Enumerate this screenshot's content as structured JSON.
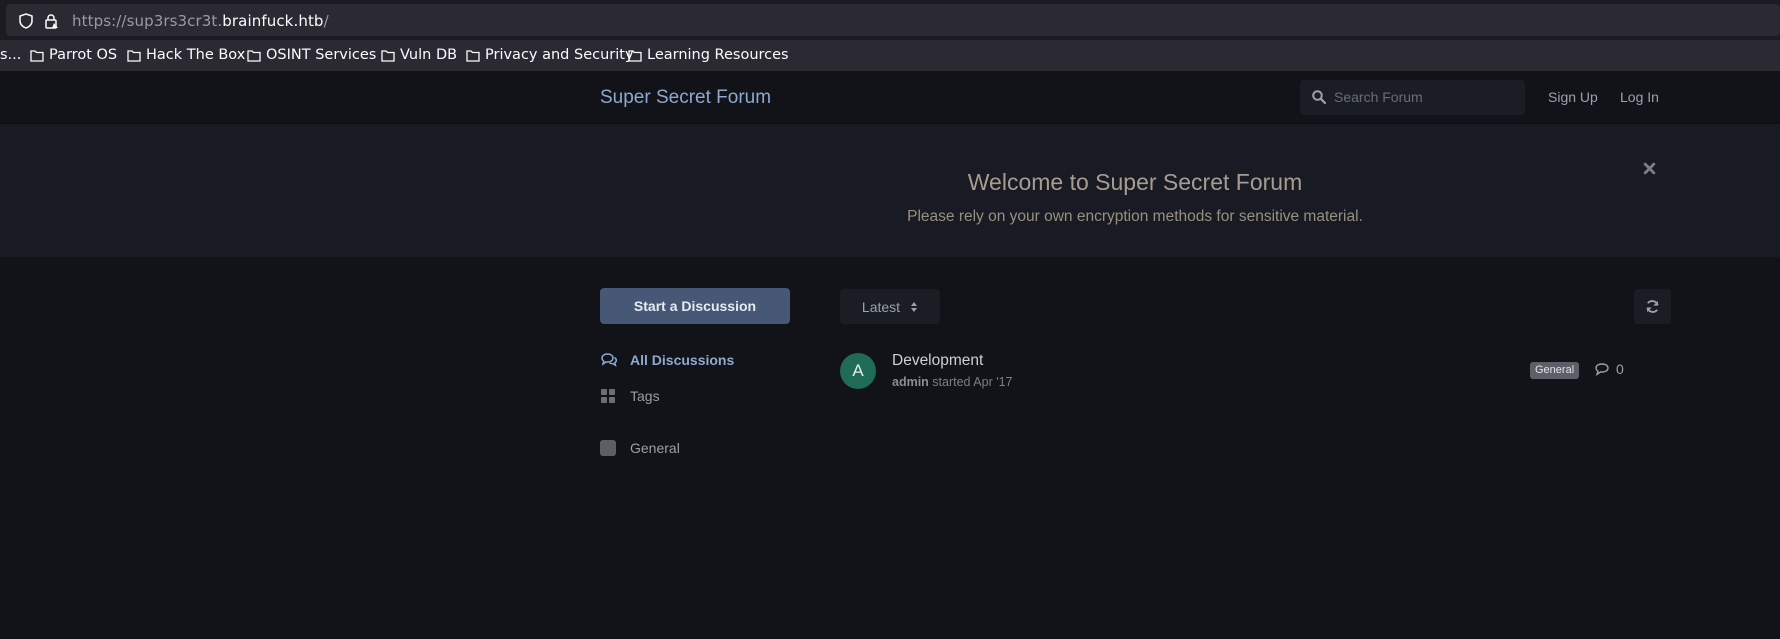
{
  "browser": {
    "url_prefix": "https://sup3rs3cr3t.",
    "url_domain": "brainfuck.htb",
    "url_suffix": "/",
    "bookmarks": [
      "s...",
      "Parrot OS",
      "Hack The Box",
      "OSINT Services",
      "Vuln DB",
      "Privacy and Security",
      "Learning Resources"
    ]
  },
  "header": {
    "brand": "Super Secret Forum",
    "search_placeholder": "Search Forum",
    "signup": "Sign Up",
    "login": "Log In"
  },
  "hero": {
    "title": "Welcome to Super Secret Forum",
    "subtitle": "Please rely on your own encryption methods for sensitive material.",
    "close_icon": "close-icon"
  },
  "sidebar": {
    "start_button": "Start a Discussion",
    "nav": [
      {
        "label": "All Discussions",
        "icon": "comments-icon",
        "active": true
      },
      {
        "label": "Tags",
        "icon": "tags-grid-icon",
        "active": false
      },
      {
        "label": "General",
        "icon": "tag-square-icon",
        "active": false
      }
    ]
  },
  "toolbar": {
    "sort_label": "Latest",
    "refresh_icon": "refresh-icon"
  },
  "discussions": [
    {
      "avatar_letter": "A",
      "title": "Development",
      "author": "admin",
      "meta": " started Apr '17",
      "tag": "General",
      "replies": "0"
    }
  ],
  "colors": {
    "accent": "#8ea9cf",
    "button": "#465875",
    "avatar": "#1f6b55"
  }
}
